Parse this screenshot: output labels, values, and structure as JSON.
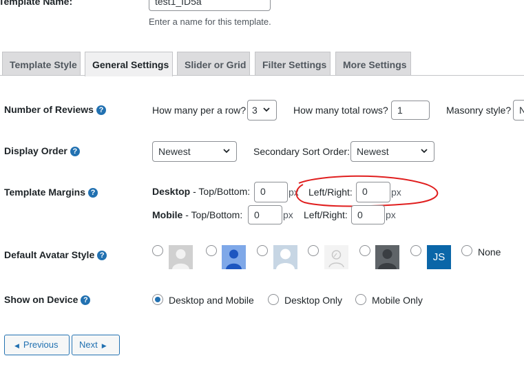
{
  "template_name": {
    "label": "Template Name:",
    "value": "test1_ID5a",
    "description": "Enter a name for this template."
  },
  "tabs": [
    {
      "label": "Template Style"
    },
    {
      "label": "General Settings",
      "active": true
    },
    {
      "label": "Slider or Grid"
    },
    {
      "label": "Filter Settings"
    },
    {
      "label": "More Settings"
    }
  ],
  "number_of_reviews": {
    "label": "Number of Reviews",
    "per_row_label": "How many per a row?",
    "per_row_value": "3",
    "total_rows_label": "How many total rows?",
    "total_rows_value": "1",
    "masonry_label": "Masonry style?",
    "masonry_value": "N"
  },
  "display_order": {
    "label": "Display Order",
    "order_value": "Newest",
    "secondary_label": "Secondary Sort Order:",
    "secondary_value": "Newest"
  },
  "template_margins": {
    "label": "Template Margins",
    "desktop_label": "Desktop",
    "desktop_topbottom": " - Top/Bottom:",
    "desktop_topbottom_value": "0",
    "desktop_px1": "px",
    "desktop_leftright": "Left/Right:",
    "desktop_leftright_value": "0",
    "desktop_px2": "px",
    "mobile_label": "Mobile",
    "mobile_topbottom": " - Top/Bottom:",
    "mobile_topbottom_value": "0",
    "mobile_px1": "px",
    "mobile_leftright": "Left/Right:",
    "mobile_leftright_value": "0",
    "mobile_px2": "px"
  },
  "default_avatar": {
    "label": "Default Avatar Style",
    "options": [
      "avatar-gray-silhouette",
      "avatar-blue-silhouette",
      "avatar-light-silhouette",
      "avatar-outline",
      "avatar-dark-silhouette",
      "avatar-initials"
    ],
    "initials": "JS",
    "none_label": "None"
  },
  "show_on_device": {
    "label": "Show on Device",
    "options": [
      {
        "label": "Desktop and Mobile",
        "checked": true
      },
      {
        "label": "Desktop Only",
        "checked": false
      },
      {
        "label": "Mobile Only",
        "checked": false
      }
    ]
  },
  "buttons": {
    "previous": "Previous",
    "next": "Next"
  },
  "colors": {
    "accent": "#2271b1",
    "annotation": "#e01e1e"
  }
}
